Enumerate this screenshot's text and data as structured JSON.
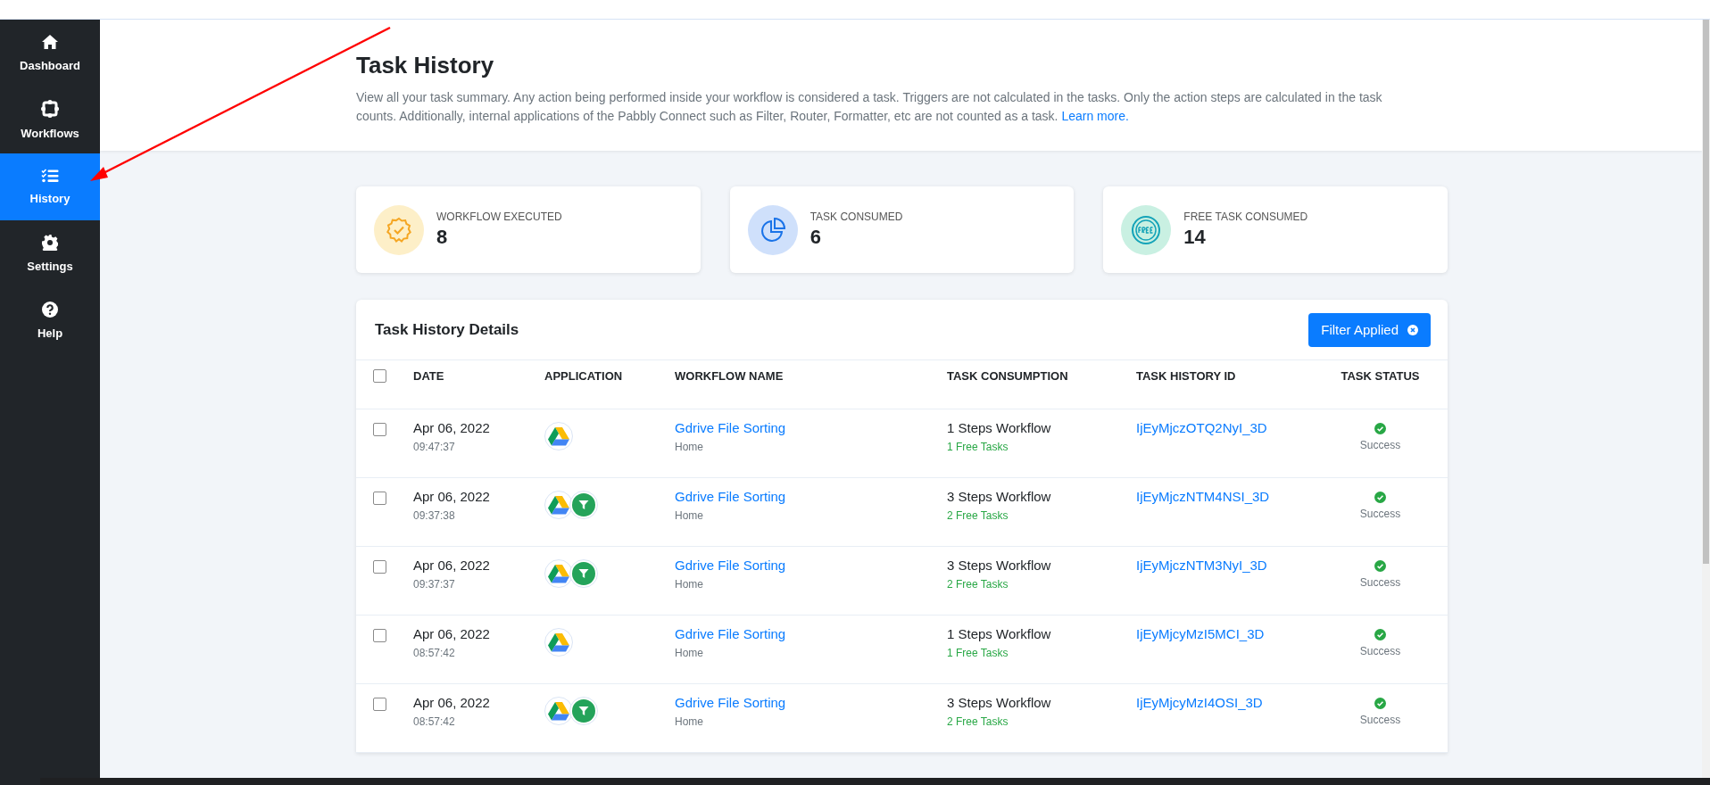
{
  "sidebar": {
    "items": [
      {
        "label": "Dashboard",
        "selected": false
      },
      {
        "label": "Workflows",
        "selected": false
      },
      {
        "label": "History",
        "selected": true
      },
      {
        "label": "Settings",
        "selected": false
      },
      {
        "label": "Help",
        "selected": false
      }
    ]
  },
  "header": {
    "title": "Task History",
    "description": "View all your task summary. Any action being performed inside your workflow is considered a task. Triggers are not calculated in the tasks. Only the action steps are calculated in the task counts. Additionally, internal applications of the Pabbly Connect such as Filter, Router, Formatter, etc are not counted as a task.",
    "link": "Learn more."
  },
  "stats": [
    {
      "label": "WORKFLOW EXECUTED",
      "value": "8"
    },
    {
      "label": "TASK CONSUMED",
      "value": "6"
    },
    {
      "label": "FREE TASK CONSUMED",
      "value": "14"
    }
  ],
  "table": {
    "title": "Task History Details",
    "filter_button": "Filter Applied",
    "select_all_checked": false,
    "columns": [
      "DATE",
      "APPLICATION",
      "WORKFLOW NAME",
      "TASK CONSUMPTION",
      "TASK HISTORY ID",
      "TASK STATUS"
    ],
    "rows": [
      {
        "checked": false,
        "date": "Apr 06, 2022",
        "time": "09:47:37",
        "apps": [
          {
            "kind": "drive"
          }
        ],
        "workflow": "Gdrive File Sorting",
        "folder": "Home",
        "consumption": "1 Steps Workflow",
        "free_tasks": "1 Free Tasks",
        "id": "IjEyMjczOTQ2NyI_3D",
        "status": "Success"
      },
      {
        "checked": false,
        "date": "Apr 06, 2022",
        "time": "09:37:38",
        "apps": [
          {
            "kind": "drive"
          },
          {
            "kind": "filter"
          }
        ],
        "workflow": "Gdrive File Sorting",
        "folder": "Home",
        "consumption": "3 Steps Workflow",
        "free_tasks": "2 Free Tasks",
        "id": "IjEyMjczNTM4NSI_3D",
        "status": "Success"
      },
      {
        "checked": false,
        "date": "Apr 06, 2022",
        "time": "09:37:37",
        "apps": [
          {
            "kind": "drive"
          },
          {
            "kind": "filter"
          }
        ],
        "workflow": "Gdrive File Sorting",
        "folder": "Home",
        "consumption": "3 Steps Workflow",
        "free_tasks": "2 Free Tasks",
        "id": "IjEyMjczNTM3NyI_3D",
        "status": "Success"
      },
      {
        "checked": false,
        "date": "Apr 06, 2022",
        "time": "08:57:42",
        "apps": [
          {
            "kind": "drive"
          }
        ],
        "workflow": "Gdrive File Sorting",
        "folder": "Home",
        "consumption": "1 Steps Workflow",
        "free_tasks": "1 Free Tasks",
        "id": "IjEyMjcyMzI5MCI_3D",
        "status": "Success"
      },
      {
        "checked": false,
        "date": "Apr 06, 2022",
        "time": "08:57:42",
        "apps": [
          {
            "kind": "drive"
          },
          {
            "kind": "filter"
          }
        ],
        "workflow": "Gdrive File Sorting",
        "folder": "Home",
        "consumption": "3 Steps Workflow",
        "free_tasks": "2 Free Tasks",
        "id": "IjEyMjcyMzI4OSI_3D",
        "status": "Success"
      }
    ]
  }
}
